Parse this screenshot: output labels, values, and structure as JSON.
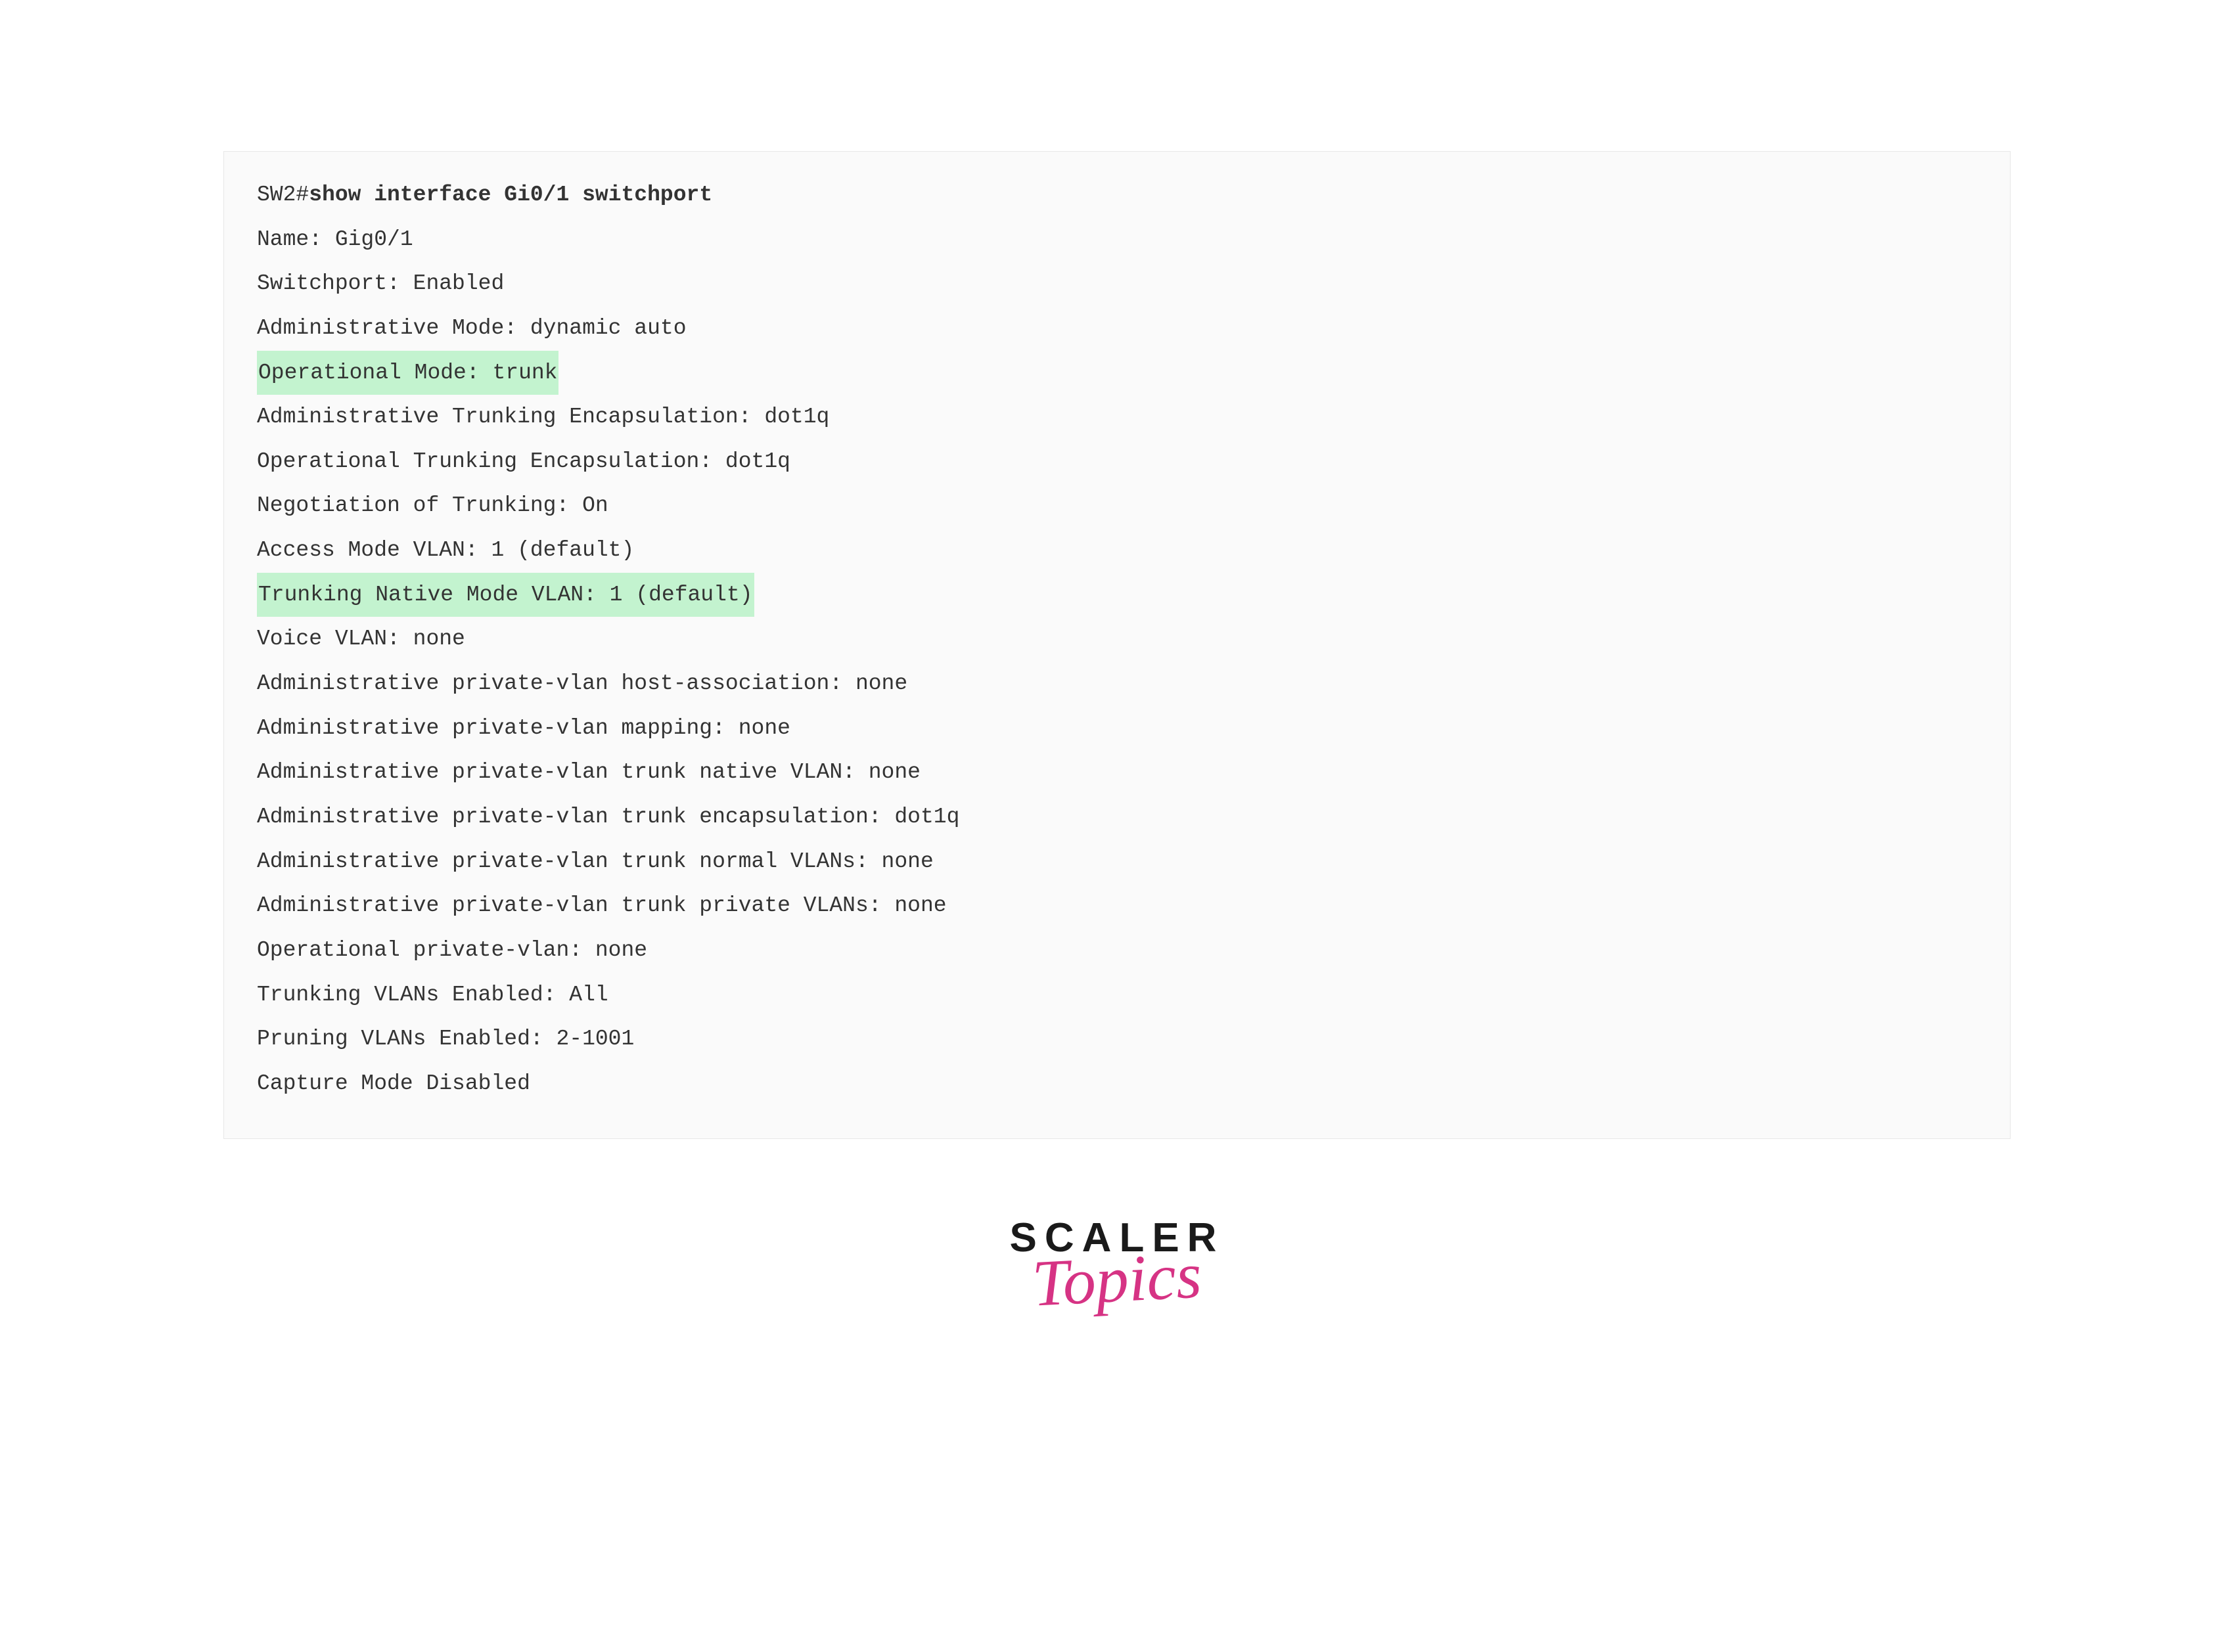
{
  "terminal": {
    "prompt": "SW2#",
    "command": "show interface Gi0/1 switchport",
    "lines": [
      {
        "text": "Name: Gig0/1",
        "highlighted": false
      },
      {
        "text": "Switchport: Enabled",
        "highlighted": false
      },
      {
        "text": "Administrative Mode: dynamic auto",
        "highlighted": false
      },
      {
        "text": "Operational Mode: trunk",
        "highlighted": true
      },
      {
        "text": "Administrative Trunking Encapsulation: dot1q",
        "highlighted": false
      },
      {
        "text": "Operational Trunking Encapsulation: dot1q",
        "highlighted": false
      },
      {
        "text": "Negotiation of Trunking: On",
        "highlighted": false
      },
      {
        "text": "Access Mode VLAN: 1 (default)",
        "highlighted": false
      },
      {
        "text": "Trunking Native Mode VLAN: 1 (default)",
        "highlighted": true
      },
      {
        "text": "Voice VLAN: none",
        "highlighted": false
      },
      {
        "text": "Administrative private-vlan host-association: none",
        "highlighted": false
      },
      {
        "text": "Administrative private-vlan mapping: none",
        "highlighted": false
      },
      {
        "text": "Administrative private-vlan trunk native VLAN: none",
        "highlighted": false
      },
      {
        "text": "Administrative private-vlan trunk encapsulation: dot1q",
        "highlighted": false
      },
      {
        "text": "Administrative private-vlan trunk normal VLANs: none",
        "highlighted": false
      },
      {
        "text": "Administrative private-vlan trunk private VLANs: none",
        "highlighted": false
      },
      {
        "text": "Operational private-vlan: none",
        "highlighted": false
      },
      {
        "text": "Trunking VLANs Enabled: All",
        "highlighted": false
      },
      {
        "text": "Pruning VLANs Enabled: 2-1001",
        "highlighted": false
      },
      {
        "text": "Capture Mode Disabled",
        "highlighted": false
      }
    ]
  },
  "logo": {
    "line1": "SCALER",
    "line2": "Topics"
  }
}
